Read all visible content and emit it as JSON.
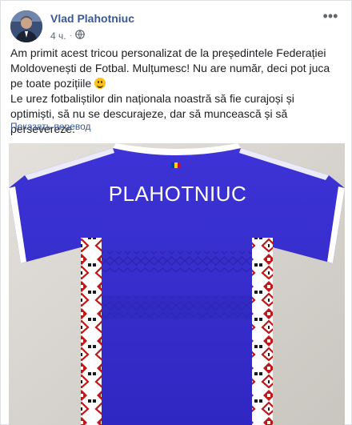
{
  "post": {
    "author": "Vlad Plahotniuc",
    "time": "4 ч.",
    "separator": "·",
    "privacy_icon": "globe-icon",
    "more_icon": "more-options-icon",
    "text_line1": "Am primit acest tricou personalizat de la președintele Federației Moldovenești de Fotbal. Mulțumesc! Nu are număr, deci pot juca pe toate pozițiile",
    "emoji": "smile-emoji-icon",
    "text_line2": "Le urez fotbaliștilor din naționala noastră să fie curajoși și optimiști, să nu se descurajeze, dar să muncească și să persevereze.",
    "translate_link": "Показать перевод"
  },
  "photo": {
    "jersey_name": "PLAHOTNIUC",
    "colors": {
      "jersey": "#3a2fd0",
      "jersey_dark": "#2a22a8",
      "trim": "#ffffff",
      "embroidery_red": "#c01818",
      "background": "#d6d3cf"
    }
  }
}
